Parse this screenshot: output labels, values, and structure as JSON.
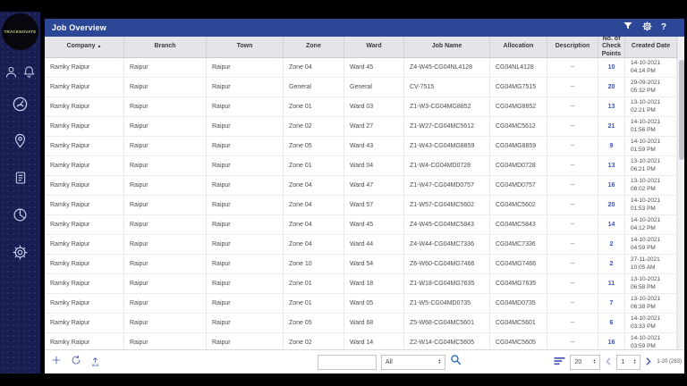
{
  "brand": {
    "logo_text": "TRACKNOVATE"
  },
  "titlebar": {
    "title": "Job Overview",
    "help_label": "?",
    "icons": [
      "filter-icon",
      "settings-gear-icon",
      "help-icon"
    ]
  },
  "sidebar": {
    "icons": [
      "user-icon",
      "notifications-bell-icon",
      "dashboard-gauge-icon",
      "tracking-pin-icon",
      "reports-document-icon",
      "analytics-pie-icon",
      "settings-gear-icon"
    ]
  },
  "table": {
    "columns": [
      "Company",
      "Branch",
      "Town",
      "Zone",
      "Ward",
      "Job Name",
      "Allocation",
      "Description",
      "No. of Check Points",
      "Created Date"
    ],
    "column_keys": [
      "company",
      "branch",
      "town",
      "zone",
      "ward",
      "job_name",
      "allocation",
      "description",
      "check_points",
      "created_date"
    ],
    "sorted_column": "Company",
    "sort_direction": "asc",
    "rows": [
      {
        "company": "Ramky Raipur",
        "branch": "Raipur",
        "town": "Raipur",
        "zone": "Zone 04",
        "ward": "Ward 45",
        "job_name": "Z4-W45-CG04NL4128",
        "allocation": "CG04NL4128",
        "description": "--",
        "check_points": "10",
        "created_date": "14-10-2021 04:14 PM"
      },
      {
        "company": "Ramky Raipur",
        "branch": "Raipur",
        "town": "Raipur",
        "zone": "General",
        "ward": "General",
        "job_name": "CV-7515",
        "allocation": "CG04MG7515",
        "description": "--",
        "check_points": "20",
        "created_date": "29-09-2021 05:32 PM"
      },
      {
        "company": "Ramky Raipur",
        "branch": "Raipur",
        "town": "Raipur",
        "zone": "Zone 01",
        "ward": "Ward 03",
        "job_name": "Z1-W3-CG04MG8852",
        "allocation": "CG04MG8852",
        "description": "--",
        "check_points": "13",
        "created_date": "13-10-2021 02:21 PM"
      },
      {
        "company": "Ramky Raipur",
        "branch": "Raipur",
        "town": "Raipur",
        "zone": "Zone 02",
        "ward": "Ward 27",
        "job_name": "Z1-W27-CG04MC5612",
        "allocation": "CG04MC5612",
        "description": "--",
        "check_points": "21",
        "created_date": "14-10-2021 01:56 PM"
      },
      {
        "company": "Ramky Raipur",
        "branch": "Raipur",
        "town": "Raipur",
        "zone": "Zone 05",
        "ward": "Ward 43",
        "job_name": "Z1-W43-CG04MG8859",
        "allocation": "CG04MG8859",
        "description": "--",
        "check_points": "9",
        "created_date": "14-10-2021 01:59 PM"
      },
      {
        "company": "Ramky Raipur",
        "branch": "Raipur",
        "town": "Raipur",
        "zone": "Zone 01",
        "ward": "Ward 04",
        "job_name": "Z1-W4-CG04MD0728",
        "allocation": "CG04MD0728",
        "description": "--",
        "check_points": "13",
        "created_date": "13-10-2021 06:21 PM"
      },
      {
        "company": "Ramky Raipur",
        "branch": "Raipur",
        "town": "Raipur",
        "zone": "Zone 04",
        "ward": "Ward 47",
        "job_name": "Z1-W47-CG04MD0757",
        "allocation": "CG04MD0757",
        "description": "--",
        "check_points": "16",
        "created_date": "13-10-2021 08:02 PM"
      },
      {
        "company": "Ramky Raipur",
        "branch": "Raipur",
        "town": "Raipur",
        "zone": "Zone 04",
        "ward": "Ward 57",
        "job_name": "Z1-W57-CG04MC5602",
        "allocation": "CG04MC5602",
        "description": "--",
        "check_points": "20",
        "created_date": "14-10-2021 01:53 PM"
      },
      {
        "company": "Ramky Raipur",
        "branch": "Raipur",
        "town": "Raipur",
        "zone": "Zone 04",
        "ward": "Ward 45",
        "job_name": "Z4-W45-CG04MC5843",
        "allocation": "CG04MC5843",
        "description": "--",
        "check_points": "14",
        "created_date": "14-10-2021 04:12 PM"
      },
      {
        "company": "Ramky Raipur",
        "branch": "Raipur",
        "town": "Raipur",
        "zone": "Zone 04",
        "ward": "Ward 44",
        "job_name": "Z4-W44-CG04MC7336",
        "allocation": "CG04MC7336",
        "description": "--",
        "check_points": "2",
        "created_date": "14-10-2021 04:59 PM"
      },
      {
        "company": "Ramky Raipur",
        "branch": "Raipur",
        "town": "Raipur",
        "zone": "Zone 10",
        "ward": "Ward 54",
        "job_name": "Z6-W60-CG04MG7466",
        "allocation": "CG04MG7466",
        "description": "--",
        "check_points": "2",
        "created_date": "27-11-2021 10:05 AM"
      },
      {
        "company": "Ramky Raipur",
        "branch": "Raipur",
        "town": "Raipur",
        "zone": "Zone 01",
        "ward": "Ward 18",
        "job_name": "Z1-W18-CG04MG7635",
        "allocation": "CG04MG7635",
        "description": "--",
        "check_points": "11",
        "created_date": "13-10-2021 06:58 PM"
      },
      {
        "company": "Ramky Raipur",
        "branch": "Raipur",
        "town": "Raipur",
        "zone": "Zone 01",
        "ward": "Ward 05",
        "job_name": "Z1-W5-CG04MD0735",
        "allocation": "CG04MD0735",
        "description": "--",
        "check_points": "7",
        "created_date": "13-10-2021 06:38 PM"
      },
      {
        "company": "Ramky Raipur",
        "branch": "Raipur",
        "town": "Raipur",
        "zone": "Zone 05",
        "ward": "Ward 68",
        "job_name": "Z5-W68-CG04MC5601",
        "allocation": "CG04MC5601",
        "description": "--",
        "check_points": "6",
        "created_date": "14-10-2021 03:33 PM"
      },
      {
        "company": "Ramky Raipur",
        "branch": "Raipur",
        "town": "Raipur",
        "zone": "Zone 02",
        "ward": "Ward 14",
        "job_name": "Z2-W14-CG04MC5605",
        "allocation": "CG04MC5605",
        "description": "--",
        "check_points": "16",
        "created_date": "14-10-2021 03:59 PM"
      }
    ]
  },
  "footer": {
    "search_value": "",
    "filter_selected": "All",
    "page_size": "20",
    "current_page": "1",
    "range_label": "1-20 (283)",
    "export_label": "XLS"
  },
  "colors": {
    "titlebar_blue": "#2b4796",
    "sidebar_navy": "#191e52",
    "link_blue": "#3f51b5",
    "header_gray": "#e4e4e9"
  }
}
